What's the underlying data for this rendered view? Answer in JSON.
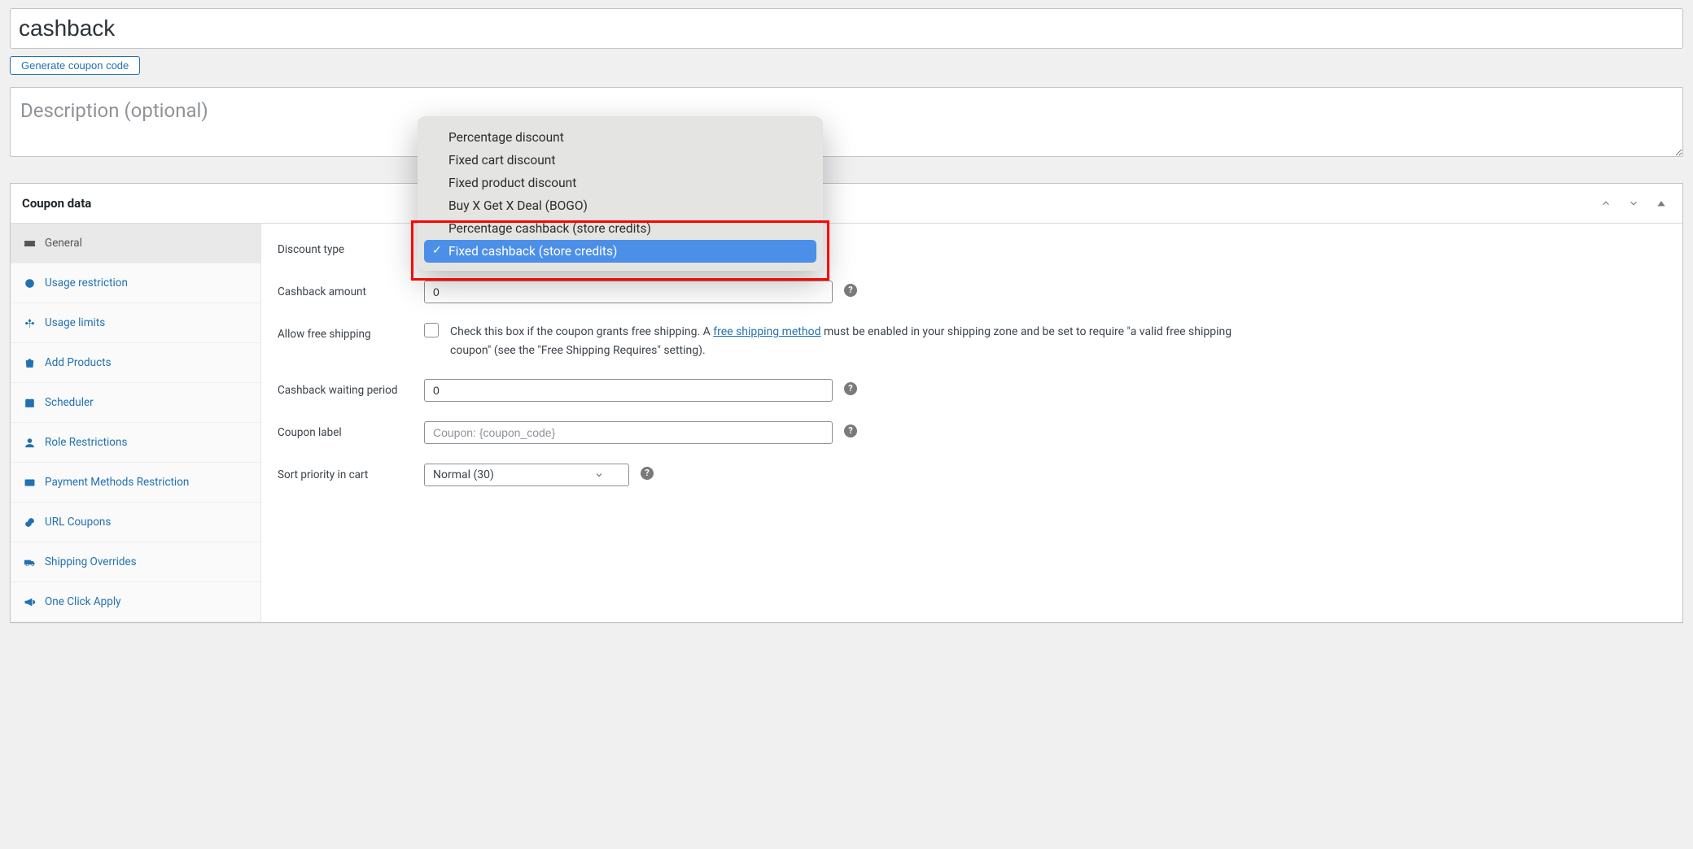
{
  "title_value": "cashback",
  "generate_btn": "Generate coupon code",
  "description_placeholder": "Description (optional)",
  "postbox_title": "Coupon data",
  "tabs": [
    {
      "label": "General"
    },
    {
      "label": "Usage restriction"
    },
    {
      "label": "Usage limits"
    },
    {
      "label": "Add Products"
    },
    {
      "label": "Scheduler"
    },
    {
      "label": "Role Restrictions"
    },
    {
      "label": "Payment Methods Restriction"
    },
    {
      "label": "URL Coupons"
    },
    {
      "label": "Shipping Overrides"
    },
    {
      "label": "One Click Apply"
    }
  ],
  "fields": {
    "discount_type_label": "Discount type",
    "cashback_amount_label": "Cashback amount",
    "cashback_amount_value": "0",
    "allow_free_shipping_label": "Allow free shipping",
    "free_shipping_pre": "Check this box if the coupon grants free shipping. A ",
    "free_shipping_link": "free shipping method",
    "free_shipping_post": " must be enabled in your shipping zone and be set to require \"a valid free shipping coupon\" (see the \"Free Shipping Requires\" setting).",
    "cashback_waiting_label": "Cashback waiting period",
    "cashback_waiting_value": "0",
    "coupon_label_label": "Coupon label",
    "coupon_label_placeholder": "Coupon: {coupon_code}",
    "sort_priority_label": "Sort priority in cart",
    "sort_priority_value": "Normal (30)"
  },
  "dropdown": {
    "options": [
      "Percentage discount",
      "Fixed cart discount",
      "Fixed product discount",
      "Buy X Get X Deal (BOGO)",
      "Percentage cashback (store credits)",
      "Fixed cashback (store credits)"
    ],
    "selected_index": 5
  }
}
